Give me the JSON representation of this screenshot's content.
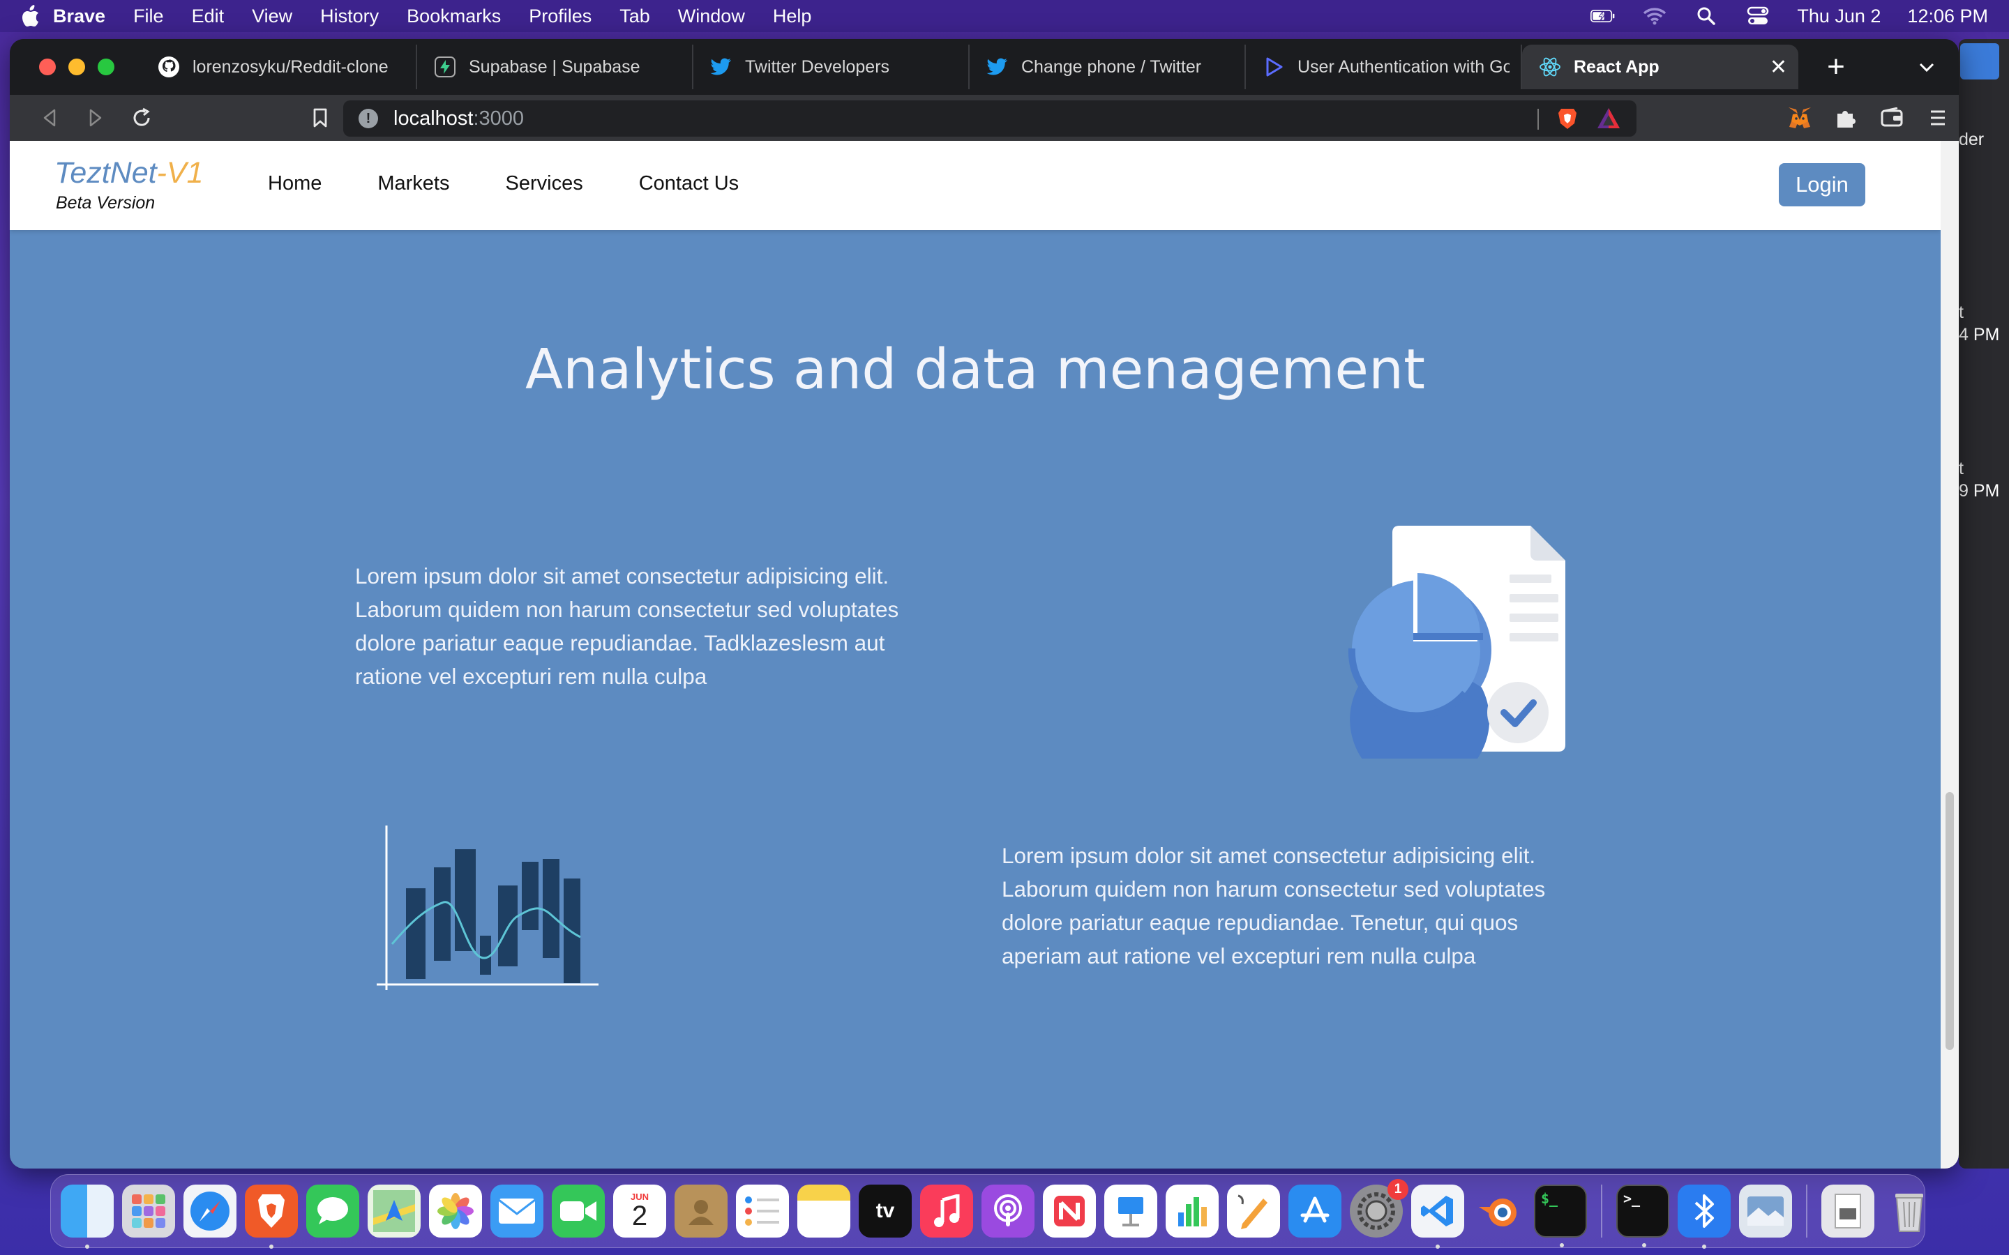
{
  "menubar": {
    "app_name": "Brave",
    "items": [
      "File",
      "Edit",
      "View",
      "History",
      "Bookmarks",
      "Profiles",
      "Tab",
      "Window",
      "Help"
    ],
    "date": "Thu Jun 2",
    "time": "12:06 PM"
  },
  "browser": {
    "tabs": [
      {
        "title": "lorenzosyku/Reddit-clone",
        "icon": "github-icon"
      },
      {
        "title": "Supabase | Supabase",
        "icon": "supabase-icon"
      },
      {
        "title": "Twitter Developers",
        "icon": "twitter-icon"
      },
      {
        "title": "Change phone / Twitter",
        "icon": "twitter-icon"
      },
      {
        "title": "User Authentication with Goo",
        "icon": "play-icon"
      },
      {
        "title": "React App",
        "icon": "react-icon",
        "active": true
      }
    ],
    "url_host": "localhost",
    "url_port": ":3000"
  },
  "site": {
    "brand": "TeztNet",
    "brand_version": "-V1",
    "brand_sub": "Beta Version",
    "nav": [
      "Home",
      "Markets",
      "Services",
      "Contact Us"
    ],
    "login_label": "Login",
    "title": "Analytics and data menagement",
    "paragraph_1": "Lorem ipsum dolor sit amet consectetur adipisicing elit. Laborum quidem non harum consectetur sed voluptates dolore pariatur eaque repudiandae. Tadklazeslesm aut ratione vel excepturi rem nulla culpa",
    "paragraph_2": "Lorem ipsum dolor sit amet consectetur adipisicing elit. Laborum quidem non harum consectetur sed voluptates dolore pariatur eaque repudiandae. Tenetur, qui quos aperiam aut ratione vel excepturi rem nulla culpa"
  },
  "peek_window": {
    "lines": [
      "der",
      "t",
      "4 PM",
      "t",
      "9 PM"
    ]
  },
  "dock": {
    "calendar_month": "JUN",
    "calendar_day": "2",
    "settings_badge": "1",
    "tv_label": "tv"
  },
  "colors": {
    "page_bg": "#5d8bc1",
    "brand_accent": "#f0b04a",
    "login_bg": "#5d8bc1"
  }
}
